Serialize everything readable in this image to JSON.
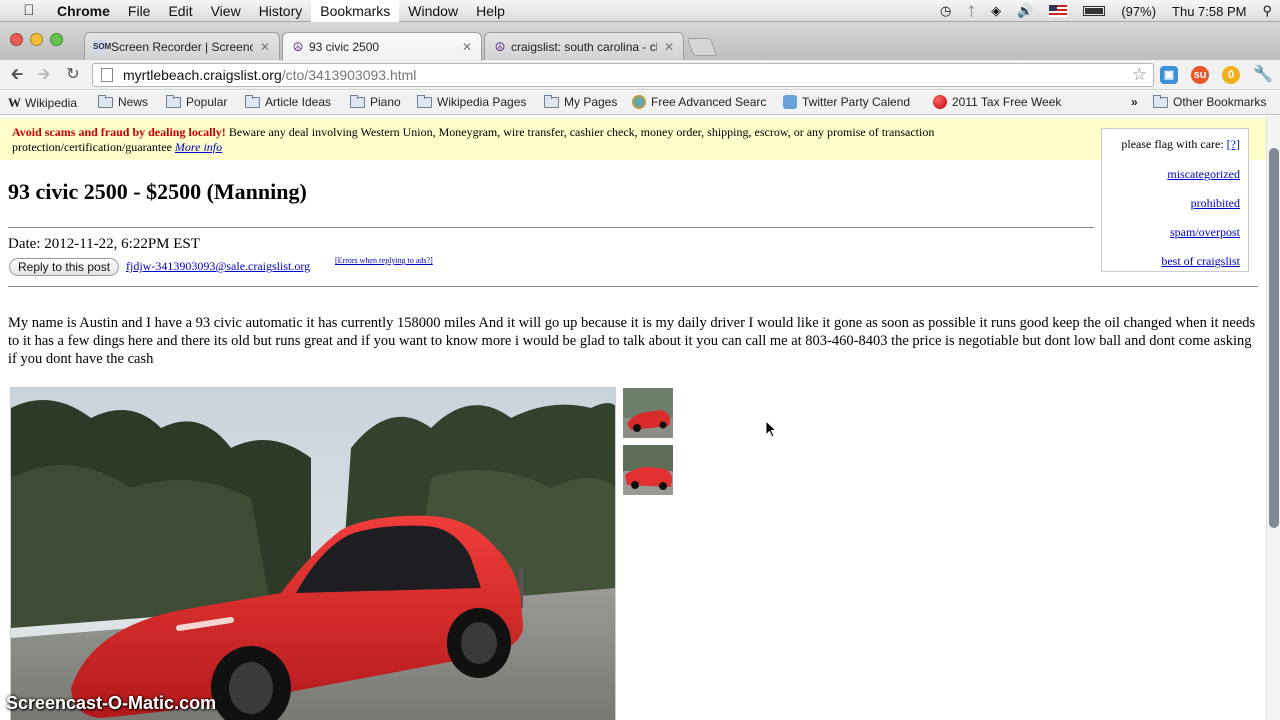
{
  "menubar": {
    "app": "Chrome",
    "items": [
      "File",
      "Edit",
      "View",
      "History",
      "Bookmarks",
      "Window",
      "Help"
    ],
    "active_item": "Bookmarks",
    "battery": "(97%)",
    "clock": "Thu 7:58 PM"
  },
  "tabs": [
    {
      "title": "Screen Recorder | Screencast-O-Matic",
      "icon": "screencast-favicon",
      "active": false
    },
    {
      "title": "93 civic 2500",
      "icon": "craigslist-peace-favicon",
      "active": true
    },
    {
      "title": "craigslist: south carolina - classifieds",
      "icon": "craigslist-peace-favicon",
      "active": false
    }
  ],
  "address": {
    "host": "myrtlebeach.craigslist.org",
    "path": "/cto/3413903093.html"
  },
  "bookmarks": [
    {
      "label": "Wikipedia",
      "type": "wikipedia"
    },
    {
      "label": "News",
      "type": "folder"
    },
    {
      "label": "Popular",
      "type": "folder"
    },
    {
      "label": "Article Ideas",
      "type": "folder"
    },
    {
      "label": "Piano",
      "type": "folder"
    },
    {
      "label": "Wikipedia Pages",
      "type": "folder"
    },
    {
      "label": "My Pages",
      "type": "folder"
    },
    {
      "label": "Free Advanced Searc",
      "type": "site"
    },
    {
      "label": "Twitter Party Calend",
      "type": "site"
    },
    {
      "label": "2011 Tax Free Week",
      "type": "site"
    },
    {
      "label": "Other Bookmarks",
      "type": "folder"
    }
  ],
  "warning": {
    "bold": "Avoid scams and fraud by dealing locally!",
    "text": " Beware any deal involving Western Union, Moneygram, wire transfer, cashier check, money order, shipping, escrow, or any promise of transaction protection/certification/guarantee ",
    "link": "More info"
  },
  "flag": {
    "heading": "please flag with care:",
    "help": "[?]",
    "options": [
      "miscategorized",
      "prohibited",
      "spam/overpost",
      "best of craigslist"
    ]
  },
  "post": {
    "title": "93 civic 2500 - $2500 (Manning)",
    "date": "Date: 2012-11-22, 6:22PM EST",
    "reply_button": "Reply to this post",
    "reply_email": "fjdjw-3413903093@sale.craigslist.org",
    "errors_link": "[Errors when replying to ads?]",
    "body": "My name is Austin and I have a 93 civic automatic it has currently 158000 miles And it will go up because it is my daily driver I would like it gone as soon as possible it runs good keep the oil changed when it needs to it has a few dings here and there its old but runs great and if you want to know more i would be glad to talk about it you can call me at 803-460-8403 the price is negotiable but dont low ball and dont come asking if you dont have the cash"
  },
  "watermark": "Screencast-O-Matic.com",
  "colors": {
    "link": "#0000cc",
    "warning_bg": "#ffffcc",
    "warning_bold": "#cc0000",
    "car_red": "#d82a2a"
  }
}
